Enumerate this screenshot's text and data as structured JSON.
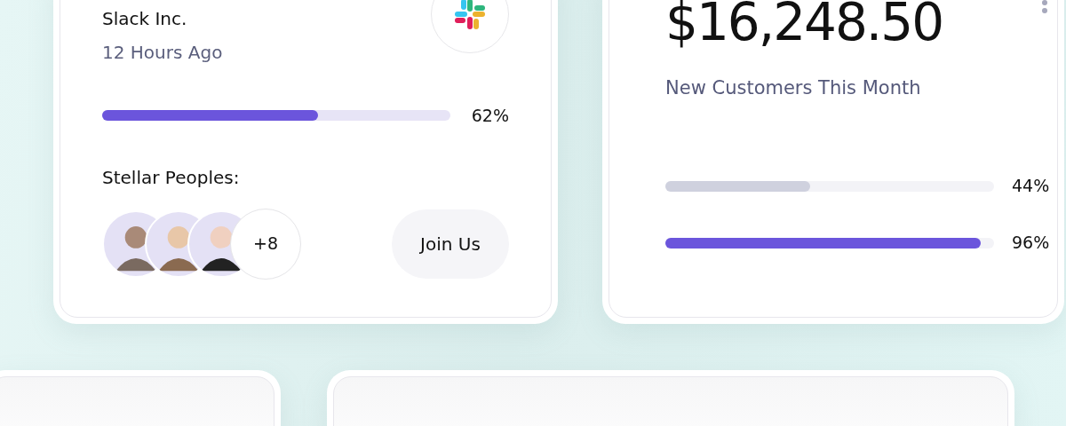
{
  "company_card": {
    "name": "Slack Inc.",
    "time": "12 Hours Ago",
    "progress": {
      "level": 0.62,
      "reading": "62%"
    },
    "team_label": "Stellar Peoples:",
    "extra_members": "+8",
    "join_button": "Join Us"
  },
  "revenue_card": {
    "amount": "$16,248.50",
    "caption": "New Customers This Month",
    "bars": [
      {
        "level": 0.44,
        "reading": "44%",
        "color": "#cfd1de"
      },
      {
        "level": 0.96,
        "reading": "96%",
        "color": "#6b55dc"
      }
    ]
  }
}
